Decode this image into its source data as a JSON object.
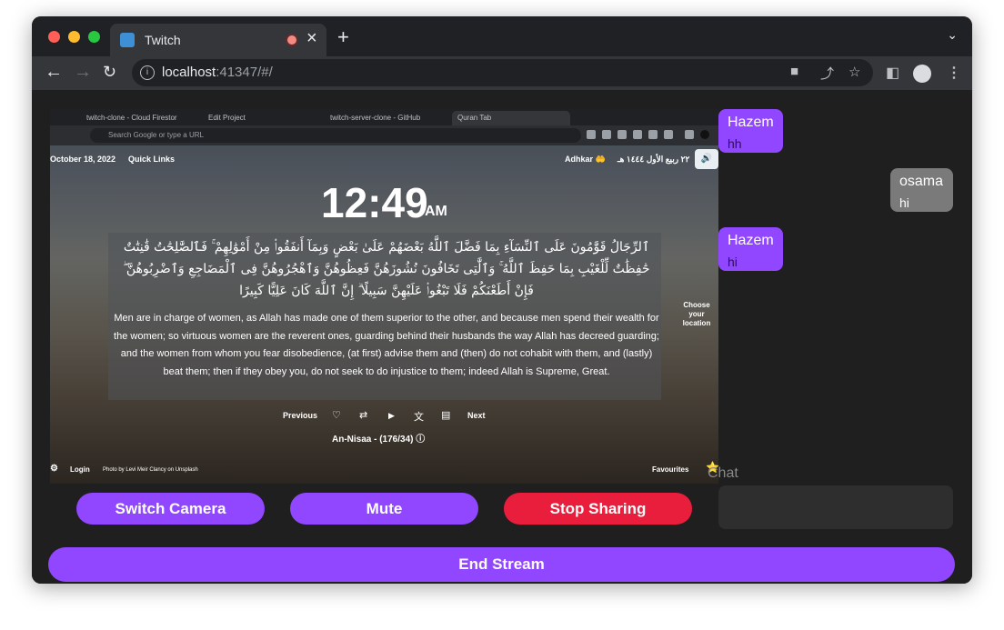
{
  "browser": {
    "tab_title": "Twitch",
    "url_host": "localhost",
    "url_rest": ":41347/#/"
  },
  "shared_screen": {
    "inner_tabs": [
      "twitch-clone - Cloud Firestor",
      "Edit Project",
      "twitch-server-clone - GitHub",
      "Quran Tab"
    ],
    "search_placeholder": "Search Google or type a URL",
    "date": "October 18, 2022",
    "quick_links": "Quick Links",
    "adhkar": "Adhkar 🤲",
    "hijri_date": "٢٢ ربيع الأول ١٤٤٤ هـ",
    "clock_time": "12:49",
    "clock_ampm": "AM",
    "verse_arabic": "ٱلرِّجَالُ قَوَّٰمُونَ عَلَى ٱلنِّسَآءِ بِمَا فَضَّلَ ٱللَّهُ بَعْضَهُمْ عَلَىٰ بَعْضٍ وَبِمَآ أَنفَقُوا۟ مِنْ أَمْوَٰلِهِمْ ۚ فَٱلصَّٰلِحَٰتُ قَٰنِتَٰتٌ حَٰفِظَٰتٌ لِّلْغَيْبِ بِمَا حَفِظَ ٱللَّهُ ۚ وَٱلَّٰتِى تَخَافُونَ نُشُوزَهُنَّ فَعِظُوهُنَّ وَٱهْجُرُوهُنَّ فِى ٱلْمَضَاجِعِ وَٱضْرِبُوهُنَّ ۖ فَإِنْ أَطَعْنَكُمْ فَلَا تَبْغُوا۟ عَلَيْهِنَّ سَبِيلًا ۗ إِنَّ ٱللَّهَ كَانَ عَلِيًّا كَبِيرًا",
    "verse_english": "Men are in charge of women, as Allah has made one of them superior to the other, and because men spend their wealth for the women; so virtuous women are the reverent ones, guarding behind their husbands the way Allah has decreed guarding; and the women from whom you fear disobedience, (at first) advise them and (then) do not cohabit with them, and (lastly) beat them; then if they obey you, do not seek to do injustice to them; indeed Allah is Supreme, Great.",
    "location_label": "Choose your location",
    "previous": "Previous",
    "next": "Next",
    "surah": "An-Nisaa - (176/34)",
    "login": "Login",
    "photo_credit": "Photo by Levi Meir Clancy on Unsplash",
    "favourites": "Favourites"
  },
  "chat": {
    "messages": [
      {
        "user": "Hazem",
        "text": "hh"
      },
      {
        "user": "osama",
        "text": "hi"
      },
      {
        "user": "Hazem",
        "text": "hi"
      }
    ],
    "label": "Chat"
  },
  "controls": {
    "switch_camera": "Switch Camera",
    "mute": "Mute",
    "stop_sharing": "Stop Sharing",
    "end_stream": "End Stream"
  },
  "colors": {
    "primary": "#9146ff",
    "danger": "#e91e3c",
    "background": "#1f1f1f"
  }
}
